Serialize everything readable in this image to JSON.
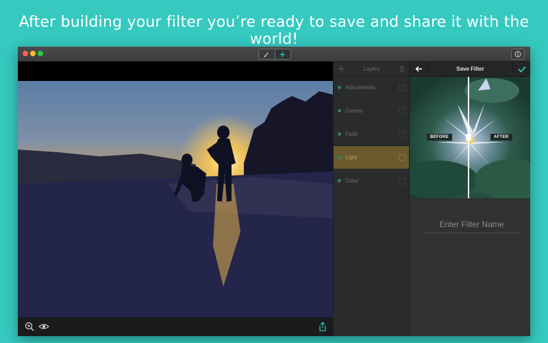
{
  "headline": "After building your filter you’re ready to save and share it with the world!",
  "layers": {
    "title": "Layers",
    "items": [
      {
        "label": "Adjustments",
        "dot": "#2f7f6e",
        "active": false
      },
      {
        "label": "Curves",
        "dot": "#2f7f6e",
        "active": false
      },
      {
        "label": "Fade",
        "dot": "#2f7f6e",
        "active": false
      },
      {
        "label": "Light",
        "dot": "#2f7f6e",
        "active": true
      },
      {
        "label": "Color",
        "dot": "#2f7f6e",
        "active": false
      }
    ]
  },
  "save": {
    "title": "Save Filter",
    "before_label": "BEFORE",
    "after_label": "AFTER",
    "name_placeholder": "Enter Filter Name"
  },
  "icons": {
    "toolbar_brush": "brush-icon",
    "toolbar_add": "plus-icon",
    "toolbar_right": "info-icon",
    "zoom": "zoom-in-icon",
    "eye": "eye-icon",
    "share": "share-icon",
    "back": "back-arrow-icon",
    "confirm": "checkmark-icon",
    "add_layer": "plus-icon",
    "delete_layer": "trash-icon"
  },
  "colors": {
    "accent": "#35c9c0",
    "active_layer": "#6b5a2c",
    "confirm": "#35c9c0"
  }
}
